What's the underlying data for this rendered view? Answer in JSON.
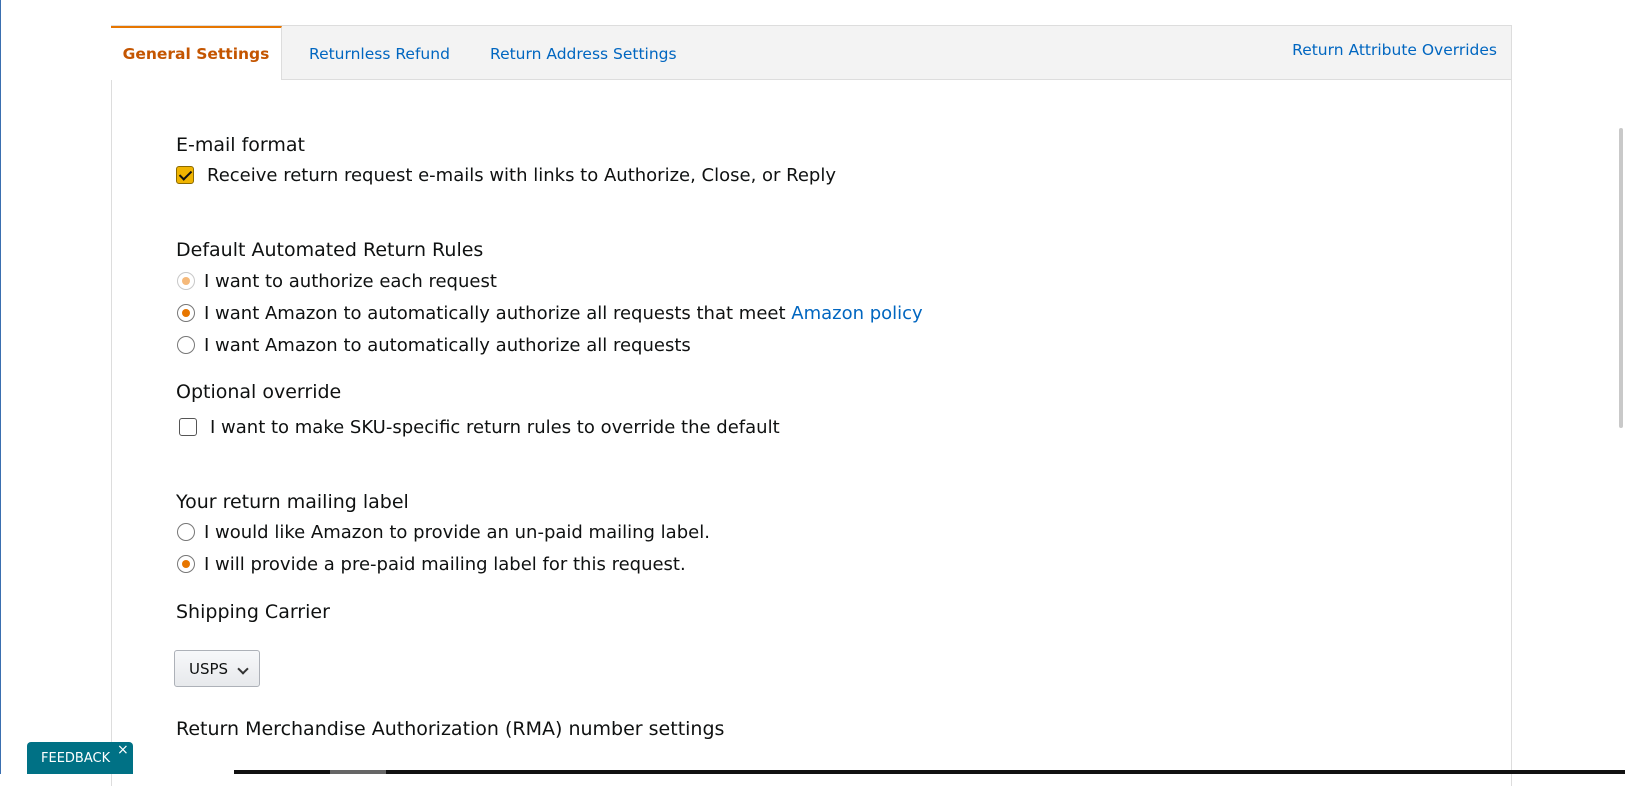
{
  "tabs": {
    "general": "General Settings",
    "returnless": "Returnless Refund",
    "address": "Return Address Settings",
    "overrides": "Return Attribute Overrides"
  },
  "email_format": {
    "heading": "E-mail format",
    "checkbox_label": "Receive return request e-mails with links to Authorize, Close, or Reply",
    "checked": true
  },
  "automated_rules": {
    "heading": "Default Automated Return Rules",
    "options": [
      {
        "label": "I want to authorize each request",
        "state": "disabled-selected"
      },
      {
        "label": "I want Amazon to automatically authorize all requests that meet ",
        "link": "Amazon policy",
        "state": "selected"
      },
      {
        "label": "I want Amazon to automatically authorize all requests",
        "state": "unselected"
      }
    ]
  },
  "optional_override": {
    "heading": "Optional override",
    "checkbox_label": "I want to make SKU-specific return rules to override the default",
    "checked": false
  },
  "mailing_label": {
    "heading": "Your return mailing label",
    "options": [
      {
        "label": "I would like Amazon to provide an un-paid mailing label.",
        "state": "unselected"
      },
      {
        "label": "I will provide a pre-paid mailing label for this request.",
        "state": "selected"
      }
    ]
  },
  "shipping_carrier": {
    "heading": "Shipping Carrier",
    "selected": "USPS"
  },
  "rma": {
    "heading": "Return Merchandise Authorization (RMA) number settings"
  },
  "feedback": {
    "label": "FEEDBACK",
    "close": "×"
  },
  "colors": {
    "accent_orange": "#e77600",
    "link_blue": "#0066c0",
    "feedback_teal": "#007185"
  }
}
